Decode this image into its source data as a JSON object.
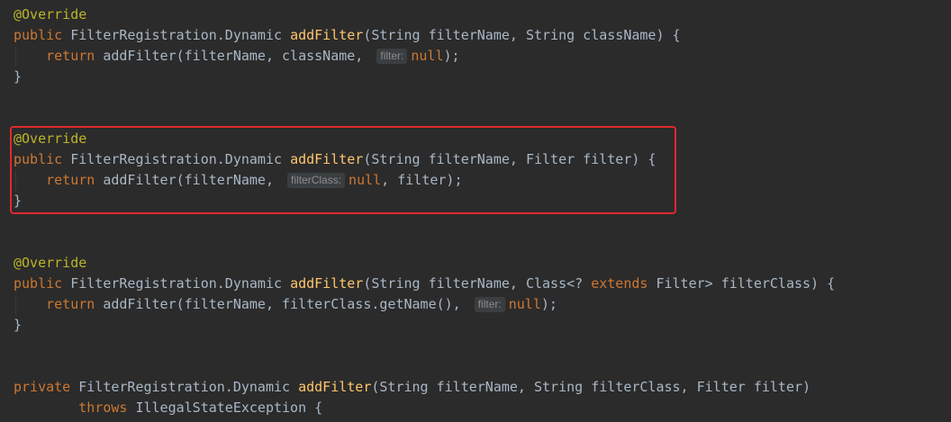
{
  "code_block_1": {
    "annotation": "@Override",
    "signature": {
      "kw_public": "public",
      "return_type": " FilterRegistration.Dynamic ",
      "method": "addFilter",
      "params": "(String filterName, String className) {"
    },
    "body": {
      "kw_return": "return",
      "before_hint": " addFilter(filterName, className, ",
      "hint": "filter:",
      "null_kw": "null",
      "tail": ");"
    },
    "close": "}"
  },
  "code_block_2": {
    "annotation": "@Override",
    "signature": {
      "kw_public": "public",
      "return_type": " FilterRegistration.Dynamic ",
      "method": "addFilter",
      "params": "(String filterName, Filter filter) {"
    },
    "body": {
      "kw_return": "return",
      "before_hint": " addFilter(filterName, ",
      "hint": "filterClass:",
      "null_kw": "null",
      "tail": ", filter);"
    },
    "close": "}"
  },
  "code_block_3": {
    "annotation": "@Override",
    "signature": {
      "kw_public": "public",
      "return_type": " FilterRegistration.Dynamic ",
      "method": "addFilter",
      "params_a": "(String filterName, Class<? ",
      "kw_extends": "extends",
      "params_b": " Filter> filterClass) {"
    },
    "body": {
      "kw_return": "return",
      "before_hint": " addFilter(filterName, filterClass.getName(), ",
      "hint": "filter:",
      "null_kw": "null",
      "tail": ");"
    },
    "close": "}"
  },
  "code_block_4": {
    "signature": {
      "kw_private": "private",
      "return_type": " FilterRegistration.Dynamic ",
      "method": "addFilter",
      "params": "(String filterName, String filterClass, Filter filter)"
    },
    "throws_line": {
      "kw_throws": "throws",
      "rest": " IllegalStateException {"
    }
  },
  "colors": {
    "background": "#2b2b2b",
    "keyword": "#cc7832",
    "annotation": "#bbb529",
    "method": "#ffc66d",
    "text": "#a9b7c6",
    "highlight_border": "#e2282d"
  }
}
